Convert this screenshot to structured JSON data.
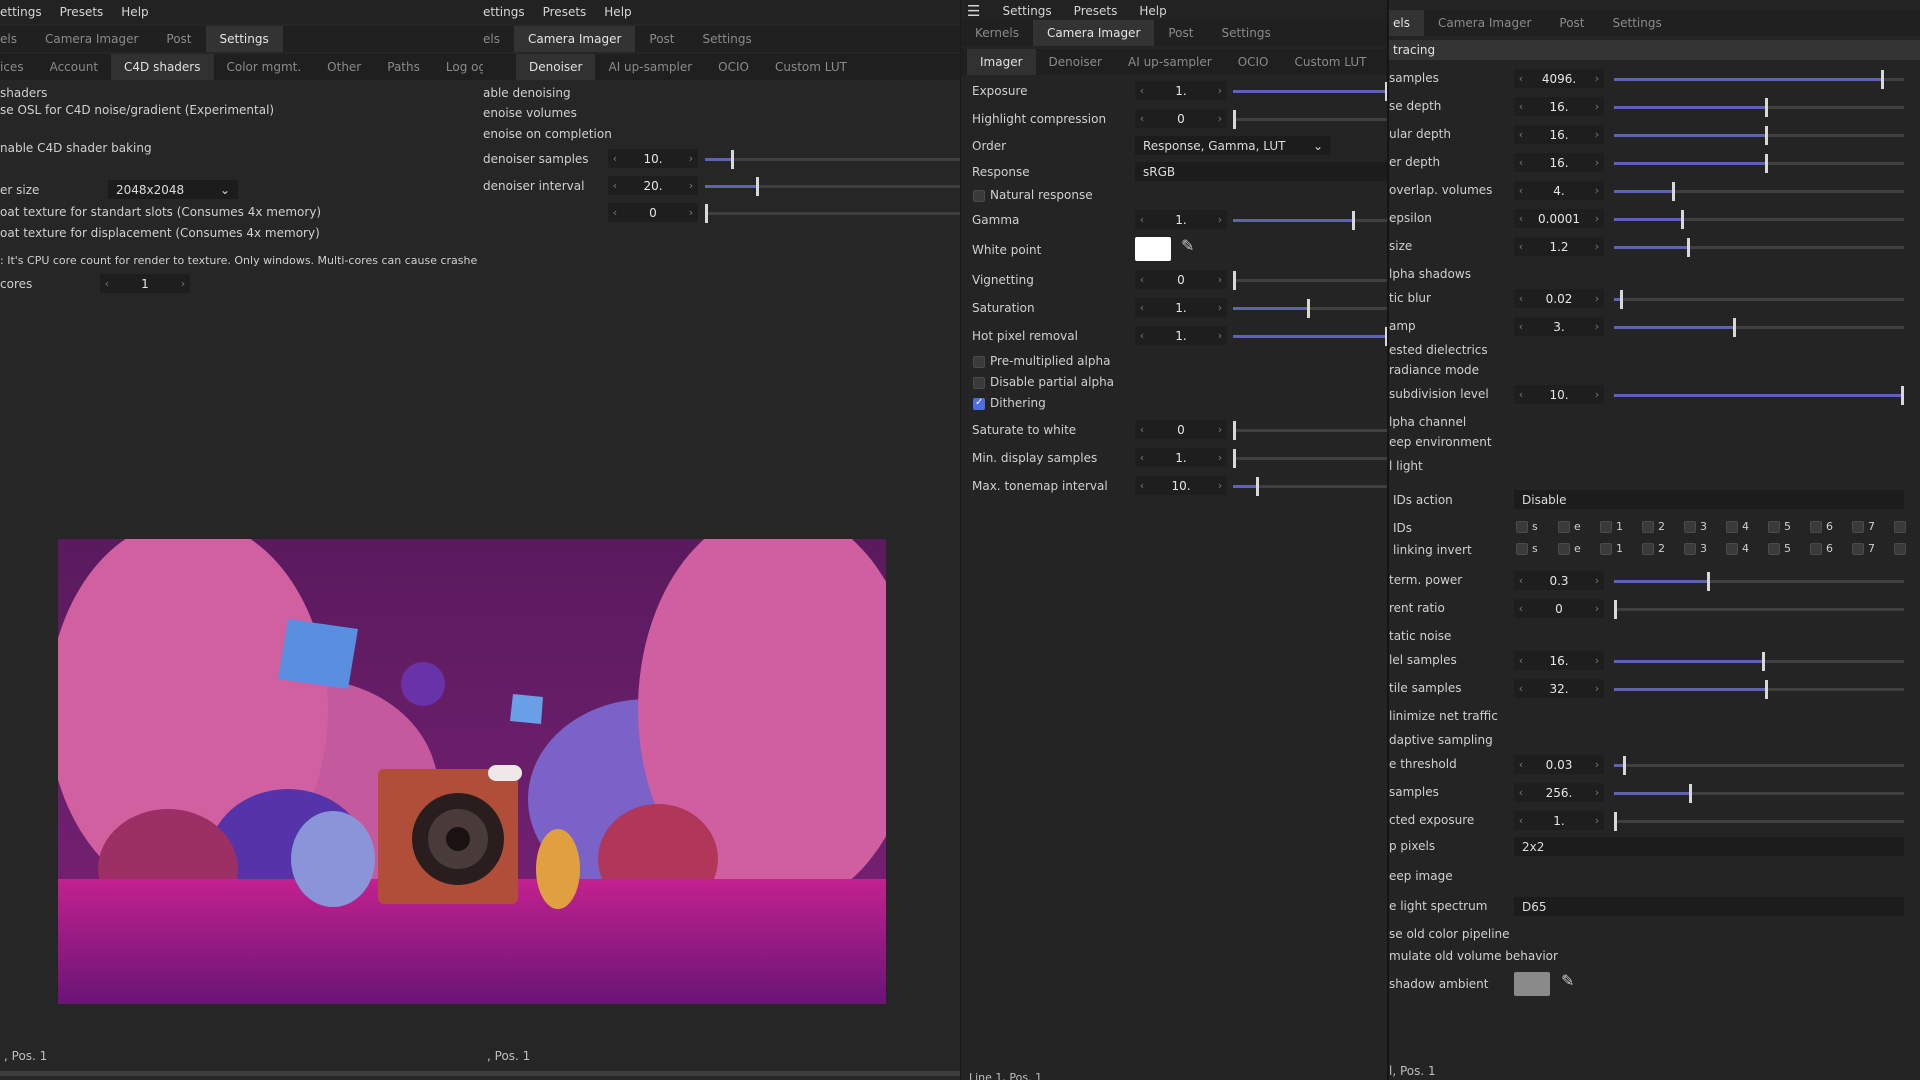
{
  "window1": {
    "menu": [
      "ettings",
      "Presets",
      "Help"
    ],
    "tabs": [
      "els",
      "Camera Imager",
      "Post",
      "Settings"
    ],
    "active_tab": "Settings",
    "subtabs": [
      "ices",
      "Account",
      "C4D shaders",
      "Color mgmt.",
      "Other",
      "Paths",
      "Log ogger"
    ],
    "active_subtab": "C4D shaders",
    "items": {
      "shaders": "shaders",
      "osl": "se OSL for C4D noise/gradient (Experimental)",
      "baking": "nable C4D shader baking",
      "buffer_size_label": "er size",
      "buffer_size_value": "2048x2048",
      "float_std": "oat texture for standart slots (Consumes 4x memory)",
      "float_disp": "oat texture for displacement (Consumes 4x memory)",
      "cpu_note": ": It's CPU core count for render to texture. Only windows. Multi-cores can cause crashe",
      "cores_label": "cores",
      "cores_value": "1"
    },
    "status": ", Pos. 1"
  },
  "window2": {
    "menu": [
      "ettings",
      "Presets",
      "Help"
    ],
    "tabs": [
      "els",
      "Camera Imager",
      "Post",
      "Settings"
    ],
    "active_tab": "Camera Imager",
    "subtabs": [
      "Denoiser",
      "AI up-sampler",
      "OCIO",
      "Custom LUT"
    ],
    "active_subtab": "Denoiser",
    "items": {
      "enable": "able denoising",
      "volumes": "enoise volumes",
      "completion": "enoise on completion",
      "samples_label": "denoiser samples",
      "samples_value": "10.",
      "samples_level": 0.1,
      "interval_label": "denoiser interval",
      "interval_value": "20.",
      "interval_level": 0.2,
      "blend_value": "0",
      "blend_level": 0
    },
    "status": ", Pos. 1"
  },
  "window3": {
    "menu": [
      "Settings",
      "Presets",
      "Help"
    ],
    "tabs": [
      "Kernels",
      "Camera Imager",
      "Post",
      "Settings"
    ],
    "active_tab": "Camera Imager",
    "subtabs": [
      "Imager",
      "Denoiser",
      "AI up-sampler",
      "OCIO",
      "Custom LUT"
    ],
    "active_subtab": "Imager",
    "exposure": {
      "label": "Exposure",
      "value": "1.",
      "level": 1.0
    },
    "highlight": {
      "label": "Highlight compression",
      "value": "0",
      "level": 0
    },
    "order": {
      "label": "Order",
      "value": "Response, Gamma, LUT"
    },
    "response": {
      "label": "Response",
      "value": "sRGB"
    },
    "natural": {
      "label": "Natural response",
      "checked": false
    },
    "gamma": {
      "label": "Gamma",
      "value": "1.",
      "level": 0.77
    },
    "white_point": {
      "label": "White point",
      "color": "#ffffff"
    },
    "vignetting": {
      "label": "Vignetting",
      "value": "0",
      "level": 0
    },
    "saturation": {
      "label": "Saturation",
      "value": "1.",
      "level": 0.48
    },
    "hot_pixel": {
      "label": "Hot pixel removal",
      "value": "1.",
      "level": 1.0
    },
    "premult": {
      "label": "Pre-multiplied alpha",
      "checked": false
    },
    "partial": {
      "label": "Disable partial alpha",
      "checked": false
    },
    "dithering": {
      "label": "Dithering",
      "checked": true
    },
    "saturate_white": {
      "label": "Saturate to white",
      "value": "0",
      "level": 0
    },
    "min_display": {
      "label": "Min. display samples",
      "value": "1.",
      "level": 0
    },
    "max_tonemap": {
      "label": "Max. tonemap interval",
      "value": "10.",
      "level": 0.15
    },
    "status": "Line 1, Pos. 1"
  },
  "window4": {
    "tabs": [
      "els",
      "Camera Imager",
      "Post",
      "Settings"
    ],
    "active_tab": "els",
    "section": "tracing",
    "rows": [
      {
        "label": "samples",
        "value": "4096.",
        "level": 0.92
      },
      {
        "label": "se depth",
        "value": "16.",
        "level": 0.52
      },
      {
        "label": "ular depth",
        "value": "16.",
        "level": 0.52
      },
      {
        "label": "er depth",
        "value": "16.",
        "level": 0.52
      },
      {
        "label": "overlap. volumes",
        "value": "4.",
        "level": 0.2
      },
      {
        "label": "epsilon",
        "value": "0.0001",
        "level": 0.23
      },
      {
        "label": "size",
        "value": "1.2",
        "level": 0.25
      },
      {
        "label": "lpha shadows"
      },
      {
        "label": "tic blur",
        "value": "0.02",
        "level": 0.02
      },
      {
        "label": "amp",
        "value": "3.",
        "level": 0.41
      },
      {
        "label": "ested dielectrics"
      },
      {
        "label": "radiance mode"
      },
      {
        "label": "subdivision level",
        "value": "10.",
        "level": 1.0
      },
      {
        "label": "lpha channel"
      },
      {
        "label": "eep environment"
      },
      {
        "label": "l light"
      }
    ],
    "ids_action": {
      "label": "IDs action",
      "value": "Disable"
    },
    "ids_row1": {
      "label": "IDs",
      "cells": [
        "s",
        "e",
        "1",
        "2",
        "3",
        "4",
        "5",
        "6",
        "7",
        ""
      ]
    },
    "ids_row2": {
      "label": "linking invert",
      "cells": [
        "s",
        "e",
        "1",
        "2",
        "3",
        "4",
        "5",
        "6",
        "7",
        ""
      ]
    },
    "rows2": [
      {
        "label": "term. power",
        "value": "0.3",
        "level": 0.32
      },
      {
        "label": "rent ratio",
        "value": "0",
        "level": 0
      },
      {
        "label": "tatic noise"
      },
      {
        "label": "lel samples",
        "value": "16.",
        "level": 0.51
      },
      {
        "label": "tile samples",
        "value": "32.",
        "level": 0.52
      },
      {
        "label": "linimize net traffic"
      },
      {
        "label": "daptive sampling"
      },
      {
        "label": "e threshold",
        "value": "0.03",
        "level": 0.03
      },
      {
        "label": "samples",
        "value": "256.",
        "level": 0.26
      },
      {
        "label": "cted exposure",
        "value": "1.",
        "level": 0
      },
      {
        "label": "p pixels",
        "dropdown": "2x2"
      },
      {
        "label": "eep image"
      },
      {
        "label": "e light spectrum",
        "dropdown": "D65"
      },
      {
        "label": "se old color pipeline"
      },
      {
        "label": "mulate old volume behavior"
      },
      {
        "label": "shadow ambient",
        "swatch": "#8a8a8a"
      }
    ],
    "status": "l, Pos. 1"
  },
  "colors": {
    "accent": "#5f63b8",
    "check": "#4d6ee0"
  }
}
